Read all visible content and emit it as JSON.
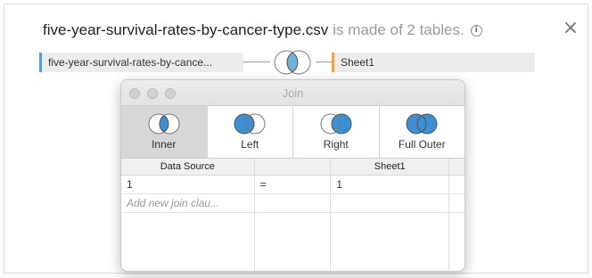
{
  "header": {
    "filename": "five-year-survival-rates-by-cancer-type.csv",
    "suffix": "is made of 2 tables.",
    "info_icon": "info-icon",
    "close_icon": "close-icon"
  },
  "tables": {
    "left": "five-year-survival-rates-by-cance...",
    "right": "Sheet1"
  },
  "dialog": {
    "title": "Join",
    "join_types": [
      {
        "label": "Inner",
        "icon": "venn-inner-icon",
        "selected": true
      },
      {
        "label": "Left",
        "icon": "venn-left-icon",
        "selected": false
      },
      {
        "label": "Right",
        "icon": "venn-right-icon",
        "selected": false
      },
      {
        "label": "Full Outer",
        "icon": "venn-full-outer-icon",
        "selected": false
      }
    ],
    "grid": {
      "headers": [
        "Data Source",
        "",
        "Sheet1",
        ""
      ],
      "rows": [
        {
          "left": "1",
          "op": "=",
          "right": "1"
        }
      ],
      "placeholder": "Add new join clau..."
    }
  },
  "colors": {
    "venn_blue": "#3d8fd1",
    "venn_inner_fill": "#6fb2d6",
    "left_accent": "#5a9bd5",
    "right_accent": "#f0a050"
  }
}
